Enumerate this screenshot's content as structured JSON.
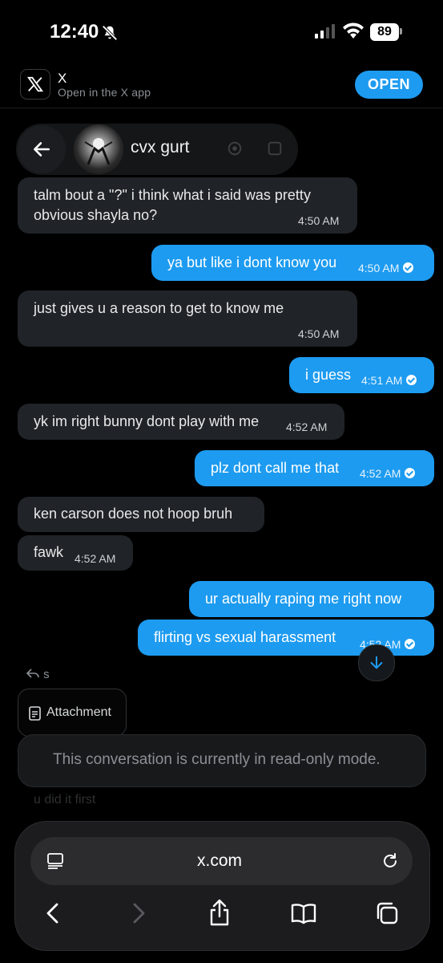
{
  "status_bar": {
    "time": "12:40",
    "battery": "89"
  },
  "banner": {
    "app_name": "X",
    "subtitle": "Open in the X app",
    "open_label": "OPEN"
  },
  "conversation": {
    "name": "cvx gurt"
  },
  "messages": [
    {
      "side": "received",
      "line1": "talm bout a \"?\" i think what i said was pretty",
      "line2": "obvious shayla no?",
      "time": "4:50 AM"
    },
    {
      "side": "sent",
      "text": "ya but like i dont know you",
      "time": "4:50 AM"
    },
    {
      "side": "received",
      "line1": "just gives u a reason to get to know me",
      "time": "4:50 AM"
    },
    {
      "side": "sent",
      "text": "i guess",
      "time": "4:51 AM"
    },
    {
      "side": "received",
      "text": "yk im right bunny dont play with me",
      "time": "4:52 AM"
    },
    {
      "side": "sent",
      "text": "plz dont call me that",
      "time": "4:52 AM"
    },
    {
      "side": "received",
      "text": "ken carson does not hoop bruh"
    },
    {
      "side": "received",
      "text": "fawk",
      "time": "4:52 AM"
    },
    {
      "side": "sent",
      "text": "ur actually raping me right now"
    },
    {
      "side": "sent",
      "text": "flirting vs sexual harassment",
      "time": "4:52 AM"
    }
  ],
  "reply_indicator": "s",
  "attachment_label": "Attachment",
  "readonly_notice": "This conversation is currently in read-only mode.",
  "faded_preview": "u did it first",
  "browser": {
    "url": "x.com"
  },
  "colors": {
    "accent": "#1d9bf0",
    "bubble_received": "#202327",
    "background": "#000000"
  }
}
